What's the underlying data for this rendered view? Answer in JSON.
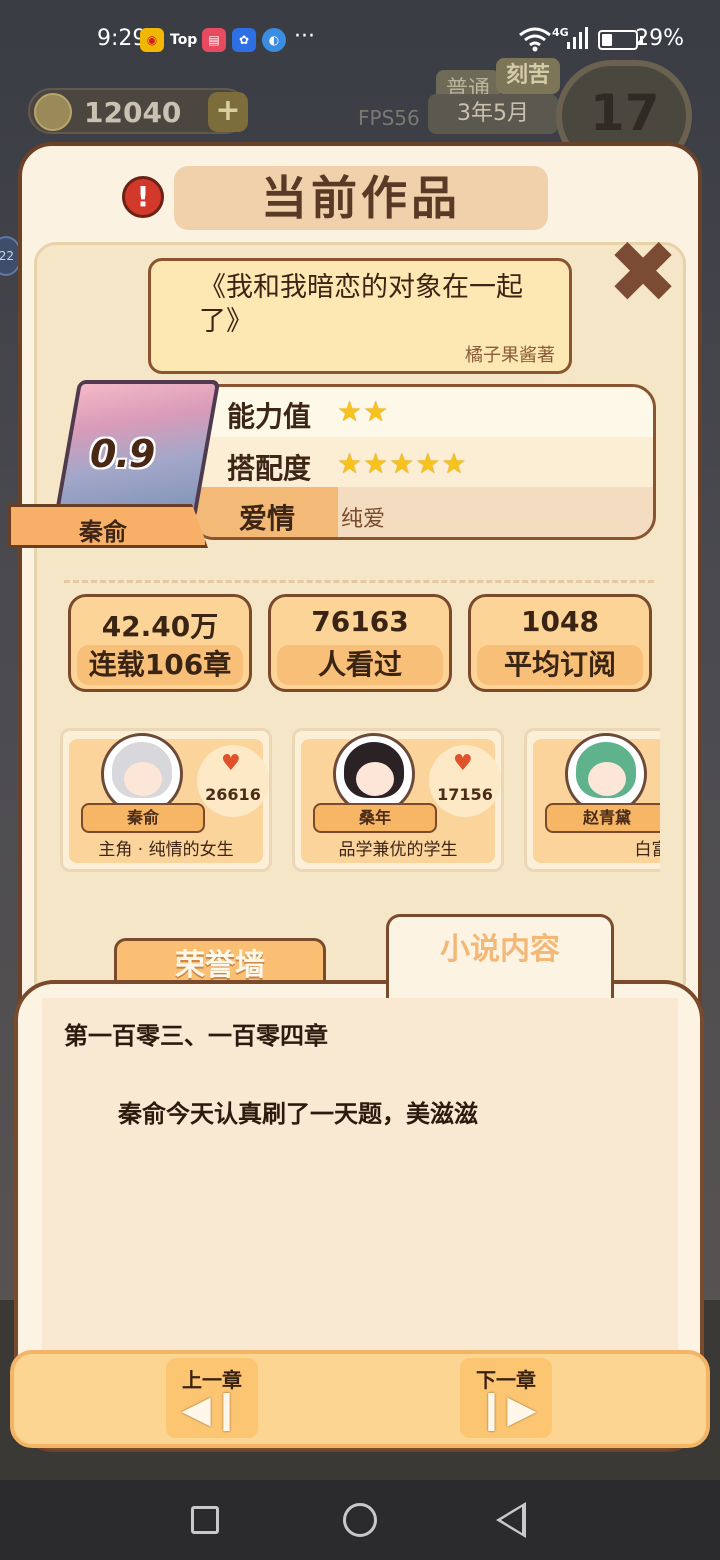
{
  "status_bar": {
    "time": "9:29",
    "app_icons": [
      "weibo-icon",
      "toutiao-icon",
      "reader-icon",
      "baidu-icon",
      "browser-icon"
    ],
    "toutiao_label": "Top",
    "more": "···",
    "network": "4G",
    "battery": "29%"
  },
  "hud": {
    "coins": "12040",
    "fps": "FPS56",
    "mode_normal": "普通",
    "mode_hard": "刻苦",
    "date": "3年5月",
    "day": "17",
    "side_badge": "22"
  },
  "modal": {
    "title": "当前作品",
    "close": "✖",
    "work_title": "《我和我暗恋的对象在一起了》",
    "author": "橘子果酱著",
    "score": "0.9",
    "protagonist": "秦俞",
    "ability_label": "能力值",
    "ability_stars": 2,
    "match_label": "搭配度",
    "match_stars": 5,
    "genre": "爱情",
    "subgenre": "纯爱",
    "stats": [
      {
        "value": "42.40万",
        "label": "连载106章"
      },
      {
        "value": "76163",
        "label": "人看过"
      },
      {
        "value": "1048",
        "label": "平均订阅"
      }
    ],
    "characters": [
      {
        "name": "秦俞",
        "likes": "26616",
        "desc": "主角 · 纯情的女生",
        "hair": "#d7d7dc"
      },
      {
        "name": "桑年",
        "likes": "17156",
        "desc": "品学兼优的学生",
        "hair": "#2a2224"
      },
      {
        "name": "赵青黛",
        "likes": "",
        "desc": "白富美",
        "hair": "#5fb38c"
      }
    ],
    "tab_honor": "荣誉墙",
    "tab_content": "小说内容",
    "chapter_title": "第一百零三、一百零四章",
    "chapter_body": "秦俞今天认真刷了一天题，美滋滋",
    "prev_chapter": "上一章",
    "next_chapter": "下一章",
    "prev_icon": "◀❙",
    "next_icon": "❙▶"
  },
  "colors": {
    "modal_bg": "#fbf2e1",
    "border_brown": "#7a4a2c",
    "accent_orange": "#f8b068",
    "star_gold": "#f6c21c"
  }
}
